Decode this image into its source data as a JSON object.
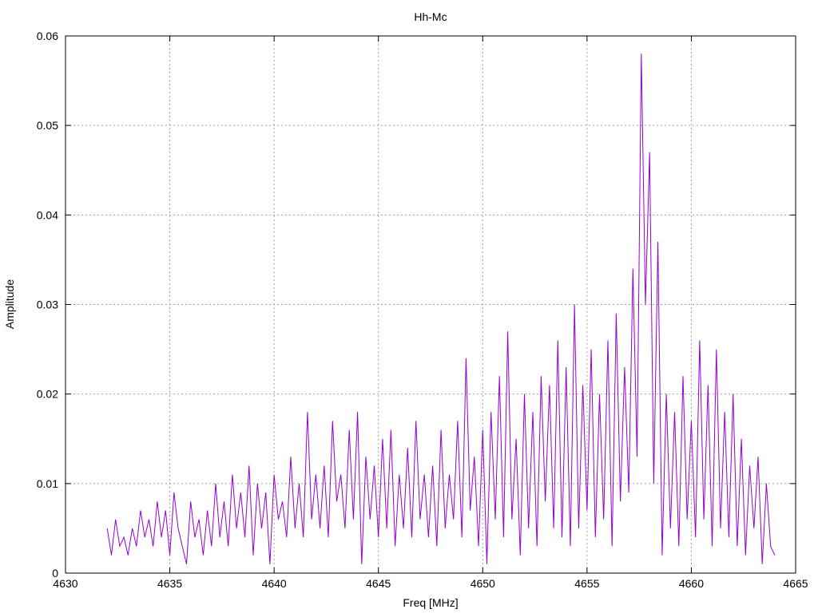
{
  "chart_data": {
    "type": "line",
    "title": "Hh-Mc",
    "xlabel": "Freq [MHz]",
    "ylabel": "Amplitude",
    "xlim": [
      4630,
      4665
    ],
    "ylim": [
      0,
      0.06
    ],
    "grid": true,
    "xticks": [
      "4630",
      "4635",
      "4640",
      "4645",
      "4650",
      "4655",
      "4660",
      "4665"
    ],
    "yticks": [
      "0",
      "0.01",
      "0.02",
      "0.03",
      "0.04",
      "0.05",
      "0.06"
    ],
    "series": [
      {
        "name": "Hh-Mc",
        "color": "#9400d3",
        "x_start": 4632,
        "x_step": 0.2,
        "values": [
          0.005,
          0.002,
          0.006,
          0.003,
          0.004,
          0.002,
          0.005,
          0.003,
          0.007,
          0.004,
          0.006,
          0.003,
          0.008,
          0.004,
          0.007,
          0.002,
          0.009,
          0.005,
          0.003,
          0.001,
          0.008,
          0.004,
          0.006,
          0.002,
          0.007,
          0.003,
          0.01,
          0.004,
          0.008,
          0.003,
          0.011,
          0.005,
          0.009,
          0.004,
          0.012,
          0.002,
          0.01,
          0.005,
          0.009,
          0.001,
          0.011,
          0.006,
          0.008,
          0.004,
          0.013,
          0.005,
          0.01,
          0.004,
          0.018,
          0.006,
          0.011,
          0.005,
          0.012,
          0.004,
          0.017,
          0.008,
          0.011,
          0.005,
          0.016,
          0.006,
          0.018,
          0.001,
          0.013,
          0.006,
          0.012,
          0.004,
          0.015,
          0.005,
          0.016,
          0.003,
          0.011,
          0.005,
          0.014,
          0.004,
          0.017,
          0.006,
          0.011,
          0.004,
          0.012,
          0.003,
          0.016,
          0.005,
          0.011,
          0.006,
          0.017,
          0.004,
          0.024,
          0.007,
          0.013,
          0.003,
          0.016,
          0.001,
          0.018,
          0.006,
          0.022,
          0.004,
          0.027,
          0.006,
          0.015,
          0.002,
          0.02,
          0.005,
          0.018,
          0.003,
          0.022,
          0.008,
          0.021,
          0.005,
          0.026,
          0.004,
          0.023,
          0.003,
          0.03,
          0.005,
          0.021,
          0.007,
          0.025,
          0.004,
          0.02,
          0.006,
          0.026,
          0.003,
          0.029,
          0.008,
          0.023,
          0.009,
          0.034,
          0.013,
          0.058,
          0.03,
          0.047,
          0.01,
          0.037,
          0.002,
          0.02,
          0.005,
          0.018,
          0.003,
          0.022,
          0.006,
          0.017,
          0.004,
          0.026,
          0.006,
          0.021,
          0.003,
          0.025,
          0.005,
          0.018,
          0.004,
          0.02,
          0.003,
          0.015,
          0.002,
          0.012,
          0.005,
          0.013,
          0.001,
          0.01,
          0.003,
          0.002
        ]
      }
    ]
  }
}
